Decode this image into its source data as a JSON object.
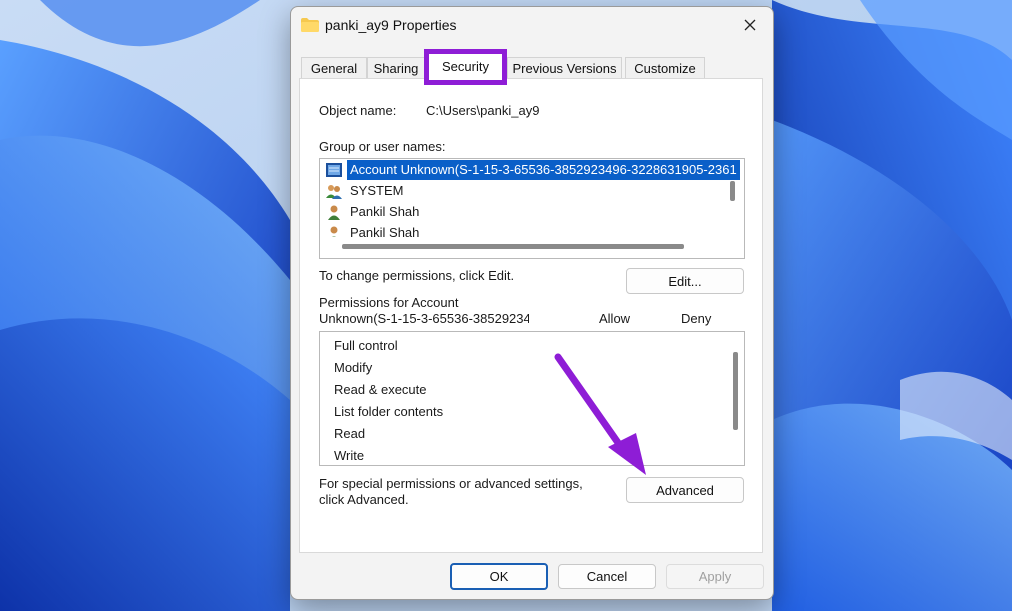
{
  "dialog": {
    "title": "panki_ay9 Properties",
    "tabs": [
      {
        "label": "General",
        "selected": false
      },
      {
        "label": "Sharing",
        "selected": false
      },
      {
        "label": "Security",
        "selected": true
      },
      {
        "label": "Previous Versions",
        "selected": false
      },
      {
        "label": "Customize",
        "selected": false
      }
    ],
    "object_name_label": "Object name:",
    "object_name_value": "C:\\Users\\panki_ay9",
    "group_label": "Group or user names:",
    "users": [
      {
        "name": "Account Unknown(S-1-15-3-65536-3852923496-3228631905-2361",
        "icon": "unknown-account-icon",
        "selected": true
      },
      {
        "name": "SYSTEM",
        "icon": "group-users-icon",
        "selected": false
      },
      {
        "name": "Pankil Shah",
        "icon": "user-icon",
        "selected": false
      },
      {
        "name": "Pankil Shah",
        "icon": "user-icon",
        "selected": false
      }
    ],
    "change_permissions_text": "To change permissions, click Edit.",
    "edit_button": "Edit...",
    "permissions_for_line1": "Permissions for Account",
    "permissions_for_line2": "Unknown(S-1-15-3-65536-38529234¦",
    "allow_header": "Allow",
    "deny_header": "Deny",
    "permissions": [
      "Full control",
      "Modify",
      "Read & execute",
      "List folder contents",
      "Read",
      "Write"
    ],
    "special_text_line1": "For special permissions or advanced settings,",
    "special_text_line2": "click Advanced.",
    "advanced_button": "Advanced",
    "ok_button": "OK",
    "cancel_button": "Cancel",
    "apply_button": "Apply"
  },
  "colors": {
    "highlight": "#8e1dd6",
    "selection": "#0a5fc8",
    "wallpaper_base": "#1e5fe6"
  }
}
